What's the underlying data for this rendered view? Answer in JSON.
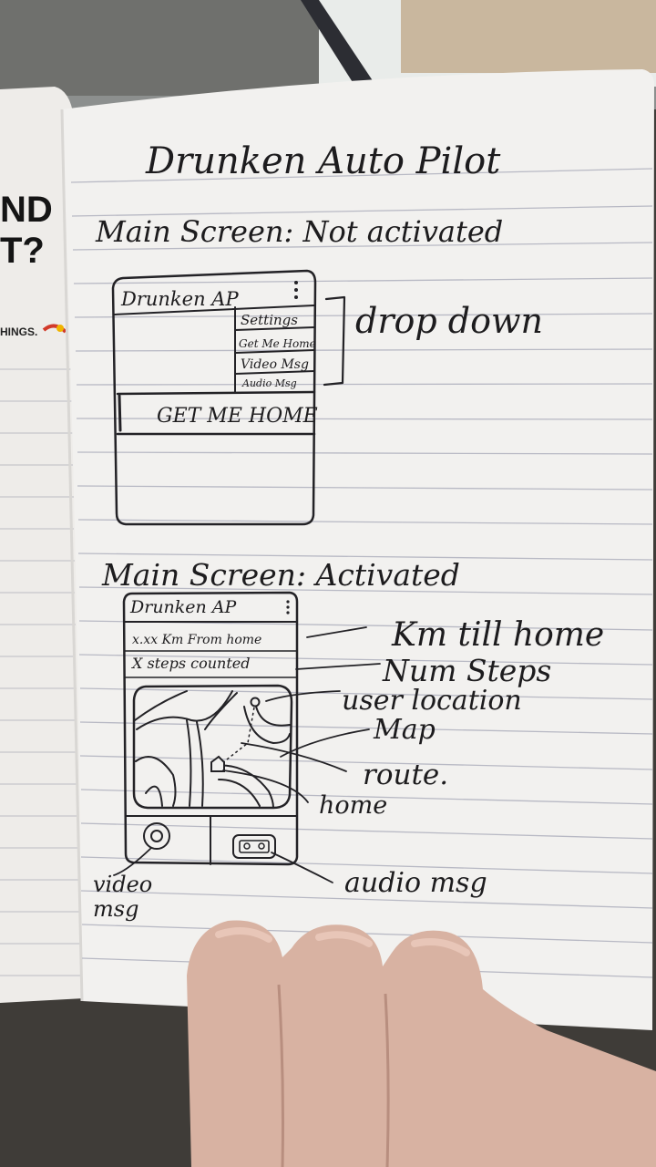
{
  "page": {
    "title": "Drunken Auto Pilot",
    "section1_heading": "Main Screen: Not activated",
    "section2_heading": "Main Screen: Activated"
  },
  "mockup1": {
    "app_title": "Drunken AP",
    "menu_items": [
      "Settings",
      "Get Me Home",
      "Video Msg",
      "Audio Msg"
    ],
    "main_button": "GET ME HOME",
    "bracket_annotation": "drop down"
  },
  "mockup2": {
    "app_title": "Drunken AP",
    "distance_text": "x.xx Km From home",
    "steps_text": "X steps counted"
  },
  "annotations": {
    "km_till_home": "Km till home",
    "num_steps": "Num Steps",
    "user_location": "user location",
    "map": "Map",
    "route": "route.",
    "home": "home",
    "video_msg_line1": "video",
    "video_msg_line2": "msg",
    "audio_msg": "audio msg"
  },
  "left_page": {
    "line1": "ND",
    "line2": "T?",
    "line3": "HINGS."
  },
  "colors": {
    "paper": "#f2f1ef",
    "ink": "#232226",
    "rule_line": "#b8b9c4",
    "background": "#3f3c38",
    "skin": "#d8b2a2"
  }
}
